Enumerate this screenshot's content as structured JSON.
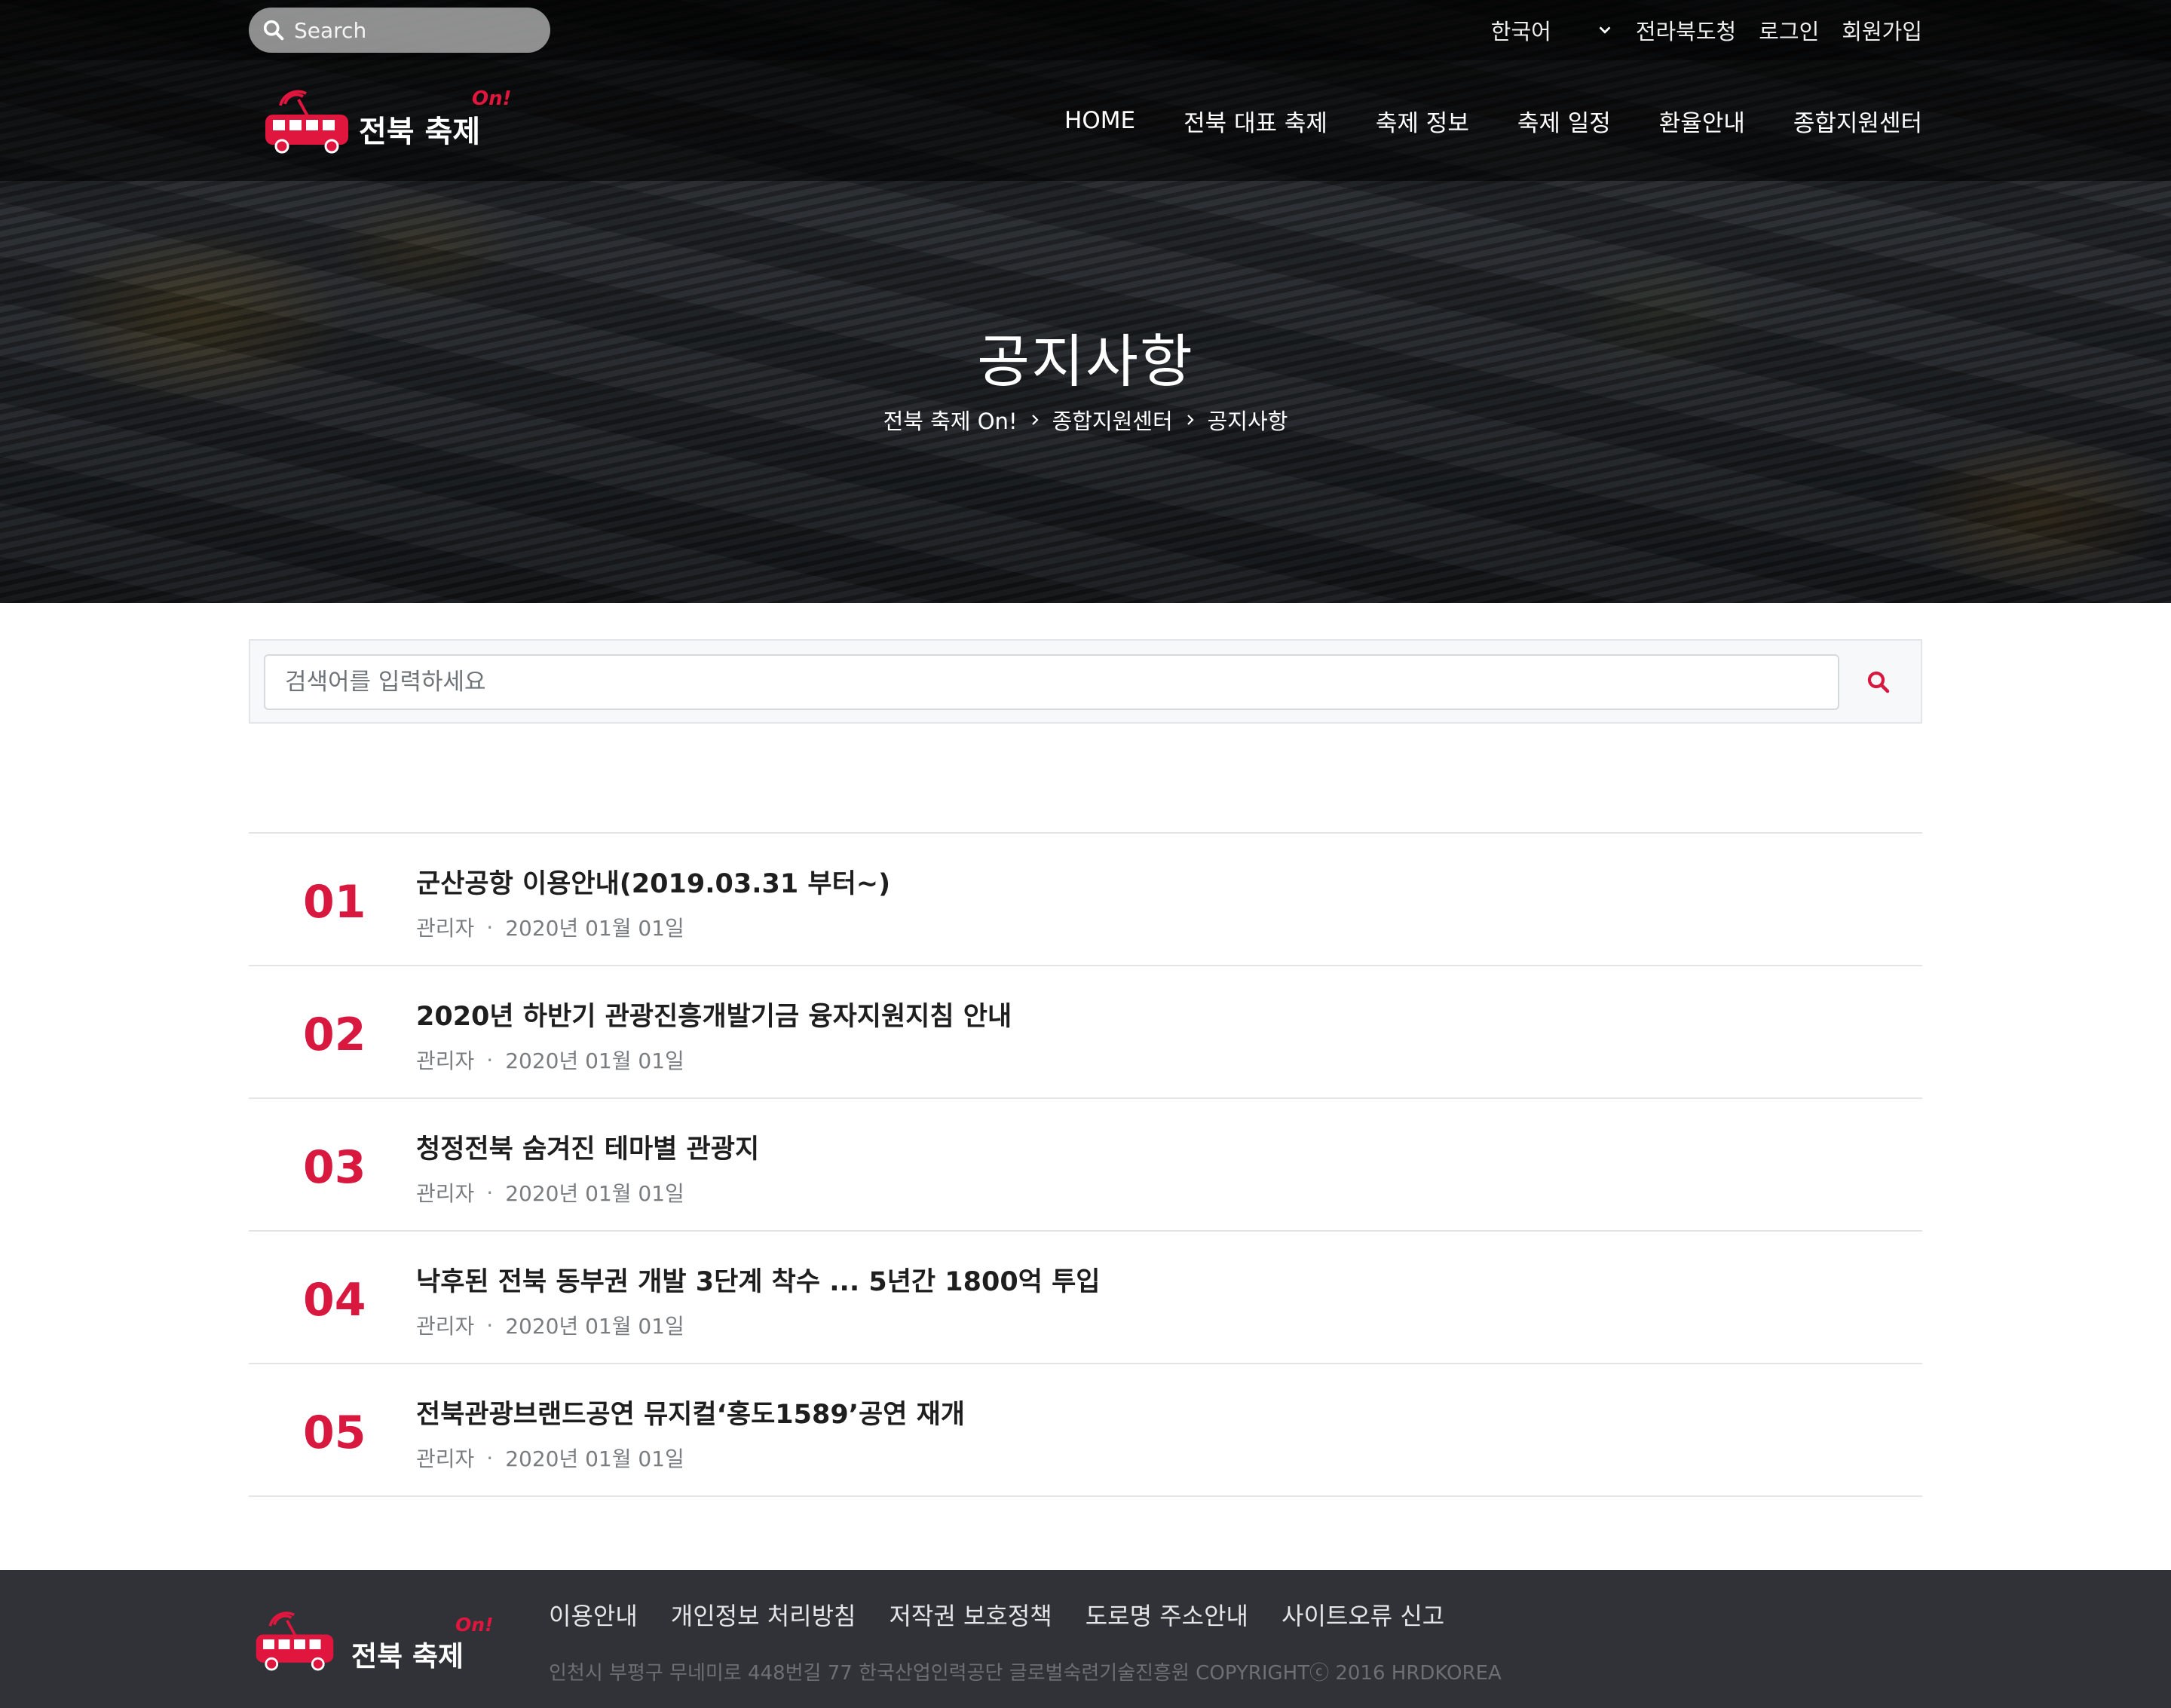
{
  "topbar": {
    "search_placeholder": "Search",
    "language": "한국어",
    "links": [
      "전라북도청",
      "로그인",
      "회원가입"
    ]
  },
  "logo": {
    "text": "전북 축제",
    "badge": "On!"
  },
  "nav": {
    "items": [
      "HOME",
      "전북 대표 축제",
      "축제 정보",
      "축제 일정",
      "환율안내",
      "종합지원센터"
    ]
  },
  "hero": {
    "title": "공지사항",
    "breadcrumb": [
      "전북 축제 On!",
      "종합지원센터",
      "공지사항"
    ]
  },
  "board_search": {
    "placeholder": "검색어를 입력하세요"
  },
  "notices": [
    {
      "num": "01",
      "title": "군산공항 이용안내(2019.03.31 부터~)",
      "author": "관리자",
      "dot": "·",
      "date": "2020년 01월 01일"
    },
    {
      "num": "02",
      "title": "2020년 하반기 관광진흥개발기금 융자지원지침 안내",
      "author": "관리자",
      "dot": "·",
      "date": "2020년 01월 01일"
    },
    {
      "num": "03",
      "title": "청정전북 숨겨진 테마별 관광지",
      "author": "관리자",
      "dot": "·",
      "date": "2020년 01월 01일"
    },
    {
      "num": "04",
      "title": "낙후된 전북 동부권 개발 3단계 착수 ... 5년간 1800억 투입",
      "author": "관리자",
      "dot": "·",
      "date": "2020년 01월 01일"
    },
    {
      "num": "05",
      "title": "전북관광브랜드공연 뮤지컬‘홍도1589’공연 재개",
      "author": "관리자",
      "dot": "·",
      "date": "2020년 01월 01일"
    }
  ],
  "footer": {
    "logo_text": "전북 축제",
    "logo_badge": "On!",
    "links": [
      "이용안내",
      "개인정보 처리방침",
      "저작권 보호정책",
      "도로명 주소안내",
      "사이트오류 신고"
    ],
    "copyright": "인천시 부평구 무네미로 448번길 77 한국산업인력공단 글로벌숙련기술진흥원 COPYRIGHTⓒ 2016 HRDKOREA"
  },
  "colors": {
    "accent": "#d8183f",
    "footer_bg": "#303237"
  },
  "icons": [
    "search-icon",
    "chevron-down-icon",
    "chevron-right-icon",
    "bus-logo-icon"
  ]
}
